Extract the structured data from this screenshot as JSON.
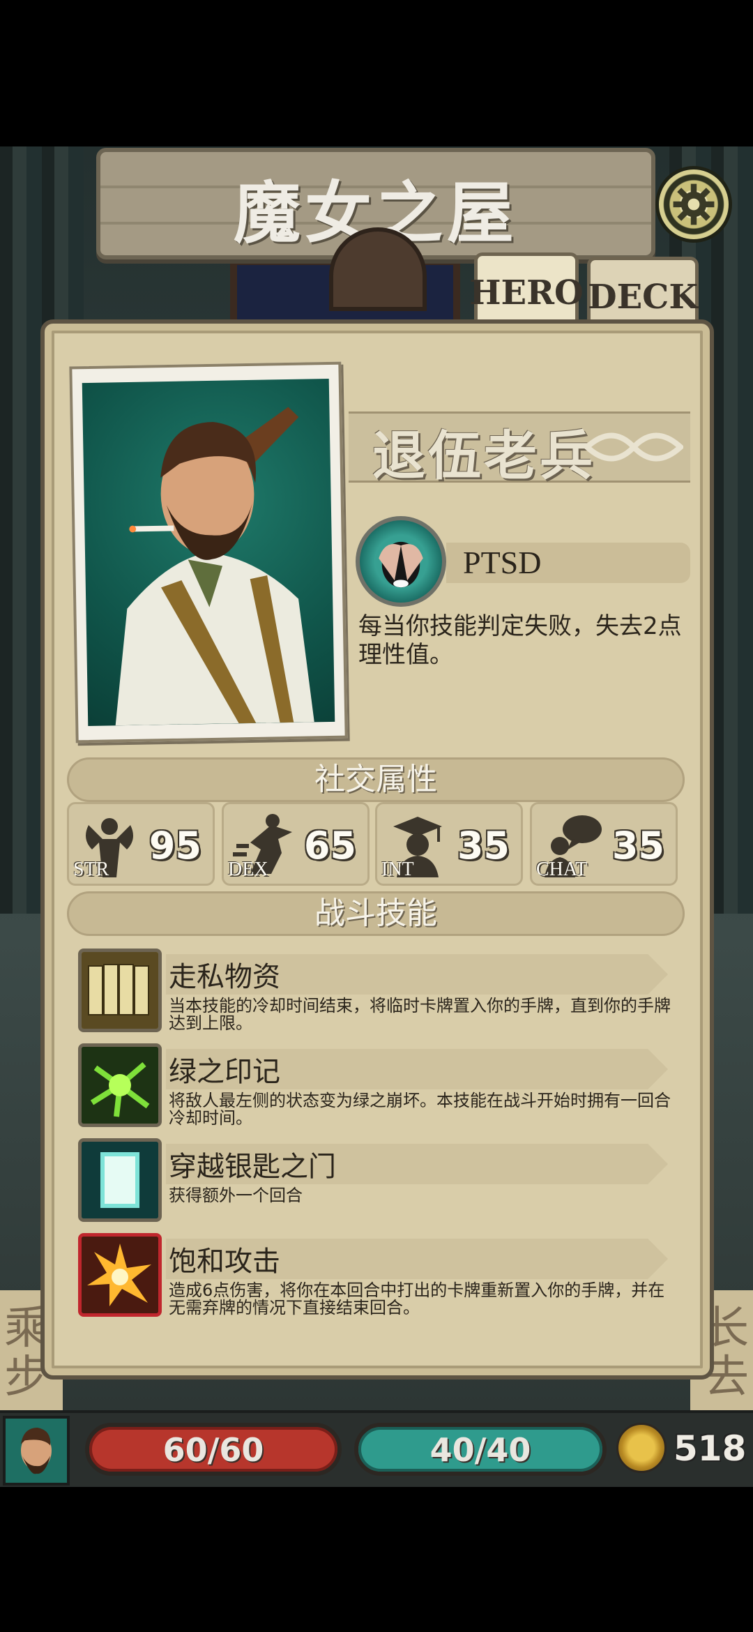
{
  "location": {
    "title": "魔女之屋"
  },
  "tabs": [
    {
      "label": "HERO",
      "selected": true
    },
    {
      "label": "DECK",
      "selected": false
    }
  ],
  "hero": {
    "class_name": "退伍老兵",
    "trait": {
      "name": "PTSD",
      "description": "每当你技能判定失败，失去2点理性值。"
    }
  },
  "social": {
    "title": "社交属性",
    "stats": [
      {
        "label": "STR",
        "value": "95",
        "icon": "muscle-icon"
      },
      {
        "label": "DEX",
        "value": "65",
        "icon": "running-icon"
      },
      {
        "label": "INT",
        "value": "35",
        "icon": "graduate-icon"
      },
      {
        "label": "CHAT",
        "value": "35",
        "icon": "speech-icon"
      }
    ]
  },
  "combat": {
    "title": "战斗技能",
    "skills": [
      {
        "name": "走私物资",
        "description": "当本技能的冷却时间结束，将临时卡牌置入你的手牌，直到你的手牌达到上限。",
        "icon": "cards-fan-icon"
      },
      {
        "name": "绿之印记",
        "description": "将敌人最左侧的状态变为绿之崩坏。本技能在战斗开始时拥有一回合冷却时间。",
        "icon": "green-mark-icon"
      },
      {
        "name": "穿越银匙之门",
        "description": "获得额外一个回合",
        "icon": "silver-gate-icon"
      },
      {
        "name": "饱和攻击",
        "description": "造成6点伤害，将你在本回合中打出的卡牌重新置入你的手牌，并在无需弃牌的情况下直接结束回合。",
        "icon": "explosion-icon"
      }
    ]
  },
  "hud": {
    "hp": "60/60",
    "sanity": "40/40",
    "gold": "518"
  },
  "colors": {
    "parchment": "#d9cda9",
    "hp_red": "#b7362c",
    "sanity_teal": "#2f9b8d"
  }
}
